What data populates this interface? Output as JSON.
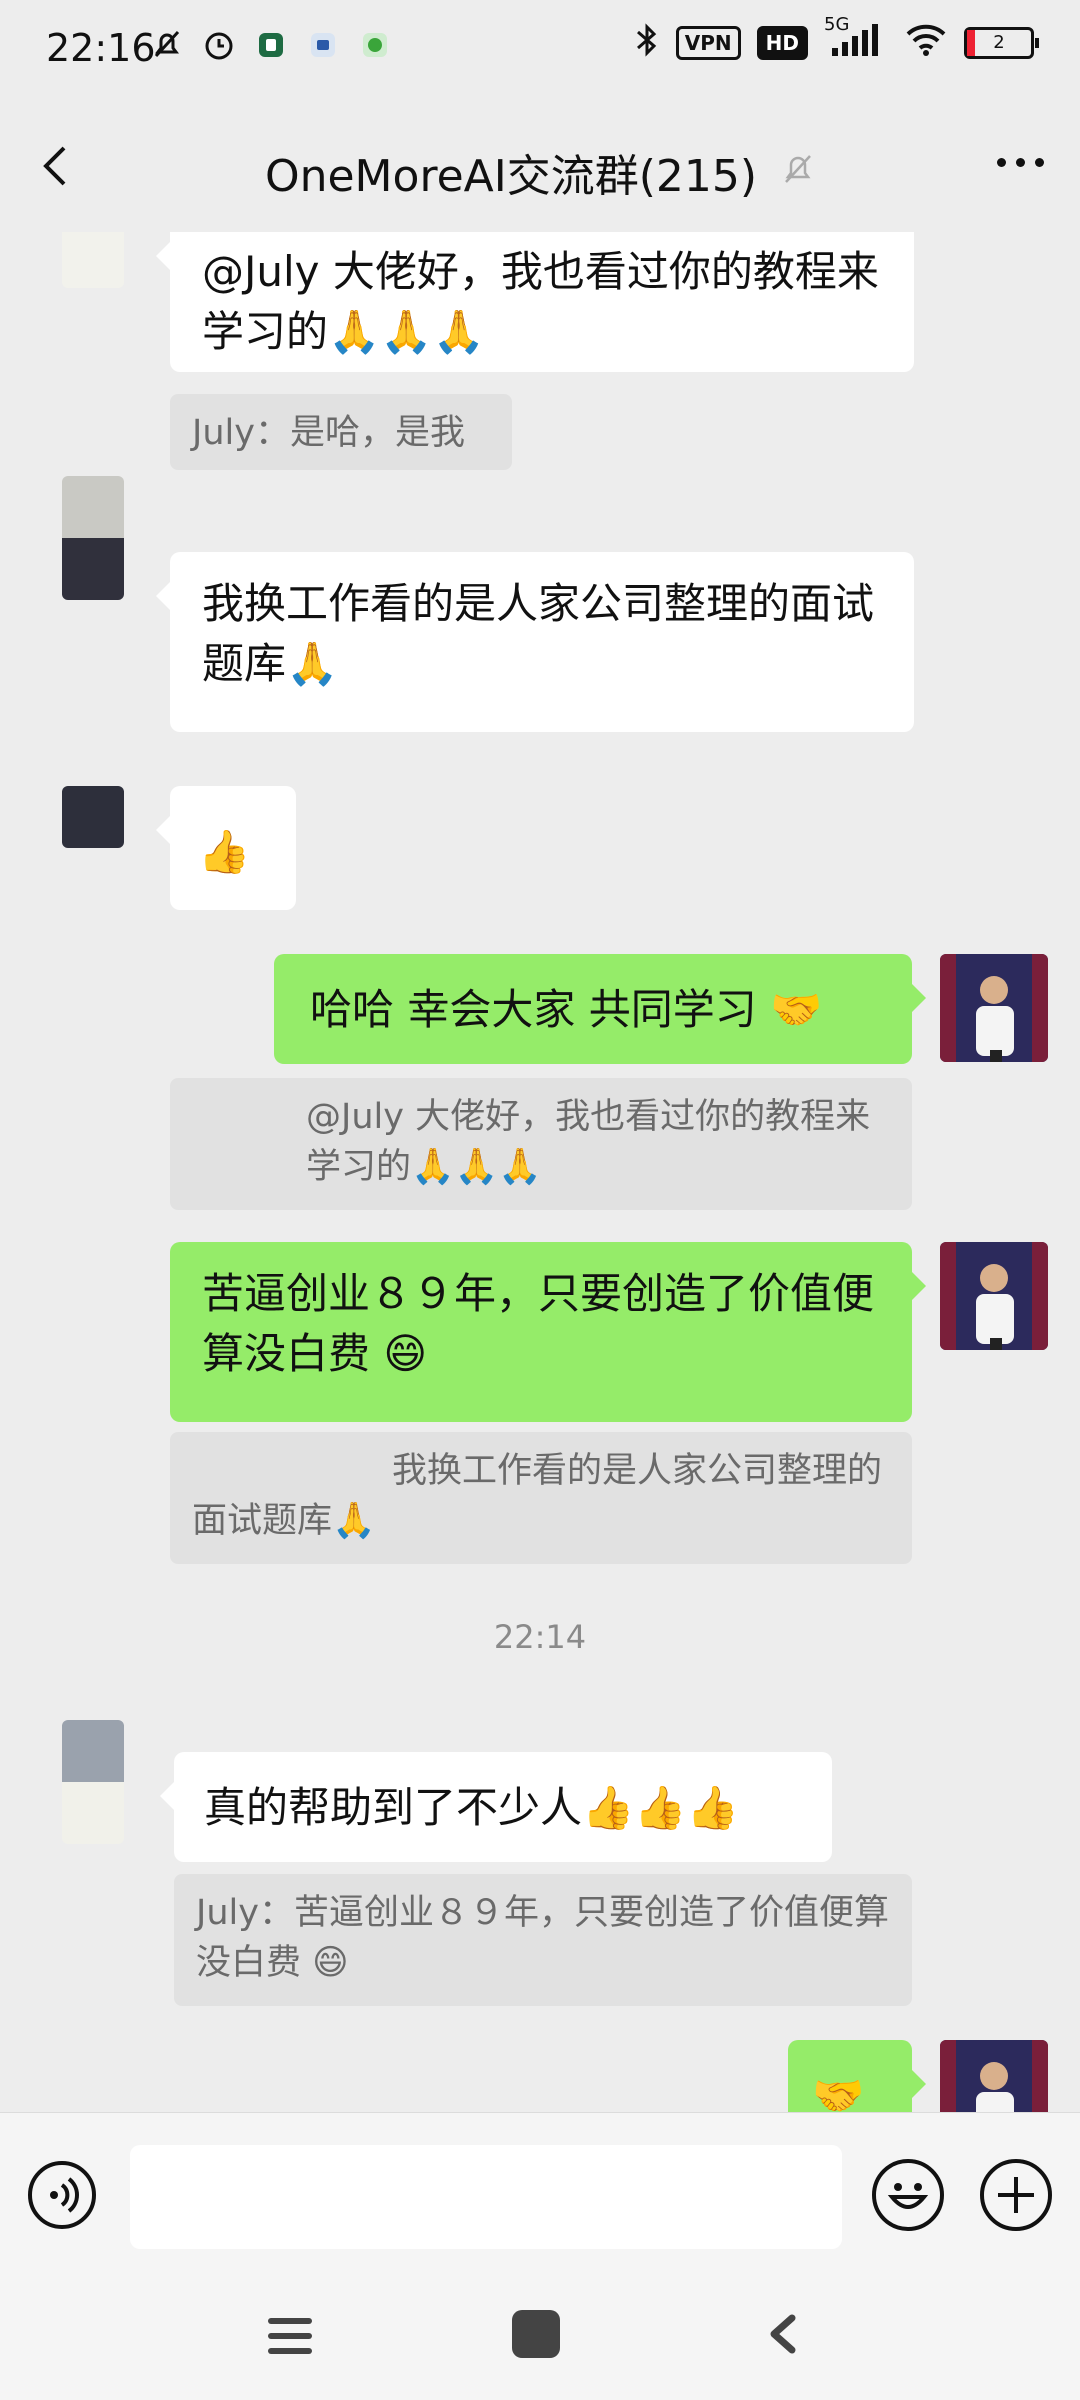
{
  "status_bar": {
    "time": "22:16",
    "vpn": "VPN",
    "hd": "HD",
    "network": "5G",
    "battery": "2"
  },
  "header": {
    "title": "OneMoreAI交流群(215)"
  },
  "messages": {
    "m1_text": "@July 大佬好，我也看过你的教程来学习的🙏🙏🙏",
    "m1_quote": "July：是哈，是我",
    "m2_text": "我换工作看的是人家公司整理的面试题库🙏",
    "m3_text": "👍",
    "m4_text": "哈哈 幸会大家 共同学习 🤝",
    "m4_quote": "@July 大佬好，我也看过你的教程来学习的🙏🙏🙏",
    "m5_text": "苦逼创业８９年，只要创造了价值便算没白费 😄",
    "m5_quote": "我换工作看的是人家公司整理的面试题库🙏",
    "timestamp": "22:14",
    "m6_text": "真的帮助到了不少人👍👍👍",
    "m6_quote": "July：苦逼创业８９年，只要创造了价值便算没白费 😄",
    "m7_text": "🤝"
  },
  "colors": {
    "chat_bg": "#ededed",
    "my_bubble": "#95ec69",
    "their_bubble": "#ffffff",
    "quote_bg": "#e1e1e1"
  },
  "icons": [
    "back-icon",
    "mute-icon",
    "more-icon",
    "voice-icon",
    "emoji-icon",
    "plus-icon",
    "nav-menu-icon",
    "nav-home-icon",
    "nav-back-icon"
  ]
}
